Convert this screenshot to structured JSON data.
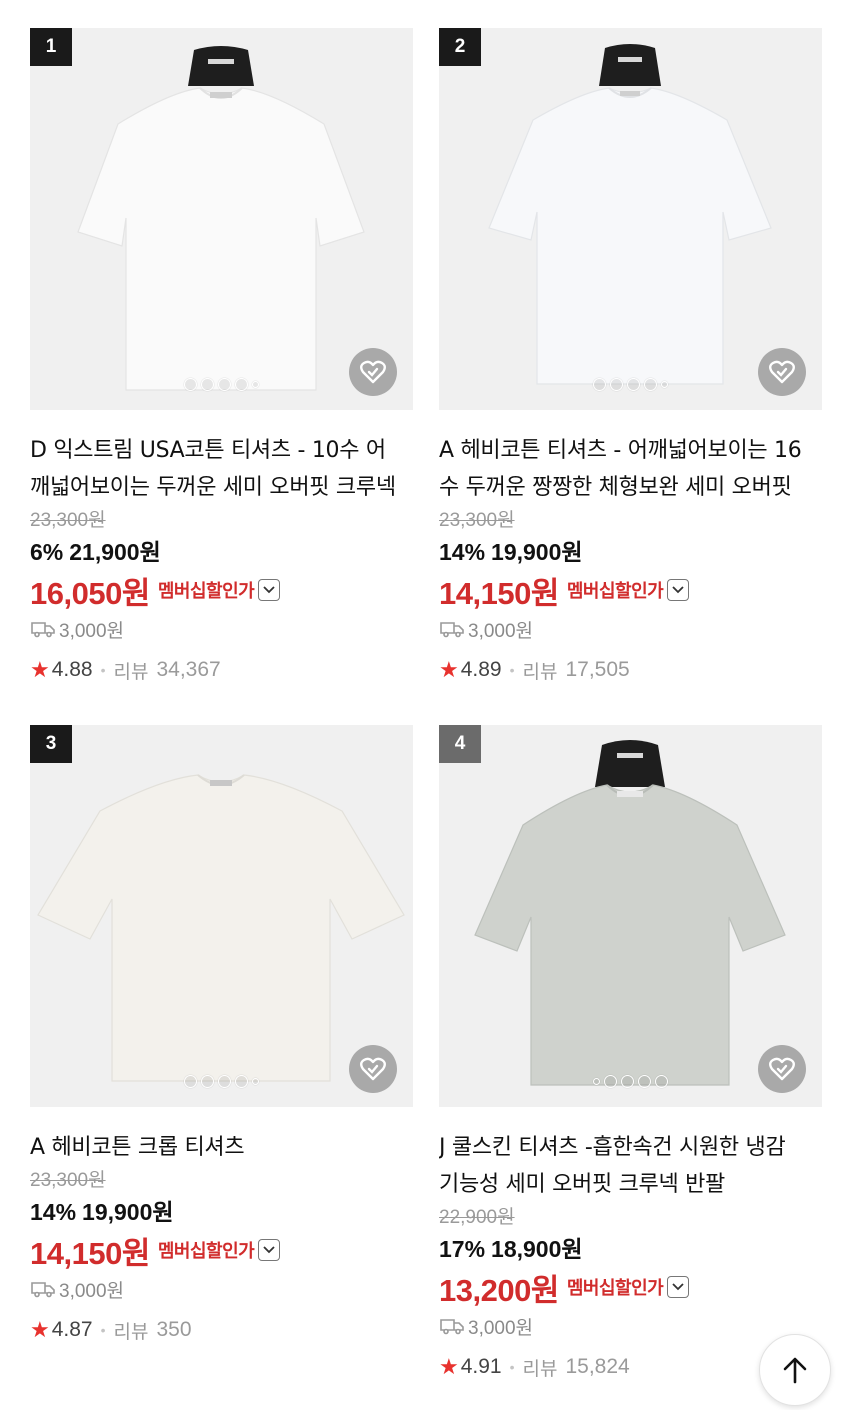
{
  "products": [
    {
      "rank": "1",
      "title": "D 익스트림 USA코튼 티셔츠 - 10수 어깨넓어보이는 두꺼운 세미 오버핏 크루넥",
      "original_price": "23,300원",
      "discount_pct": "6%",
      "sale_price": "21,900원",
      "member_price": "16,050원",
      "member_label": "멤버십할인가",
      "shipping": "3,000원",
      "rating": "4.88",
      "review_label": "리뷰",
      "review_count": "34,367",
      "shirt_color": "#fafafa",
      "hanger": true
    },
    {
      "rank": "2",
      "title": "A 헤비코튼 티셔츠 - 어깨넓어보이는 16수 두꺼운 짱짱한 체형보완 세미 오버핏",
      "original_price": "23,300원",
      "discount_pct": "14%",
      "sale_price": "19,900원",
      "member_price": "14,150원",
      "member_label": "멤버십할인가",
      "shipping": "3,000원",
      "rating": "4.89",
      "review_label": "리뷰",
      "review_count": "17,505",
      "shirt_color": "#f7f8fa",
      "hanger": true
    },
    {
      "rank": "3",
      "title": "A 헤비코튼 크롭 티셔츠",
      "original_price": "23,300원",
      "discount_pct": "14%",
      "sale_price": "19,900원",
      "member_price": "14,150원",
      "member_label": "멤버십할인가",
      "shipping": "3,000원",
      "rating": "4.87",
      "review_label": "리뷰",
      "review_count": "350",
      "shirt_color": "#f3f1ec",
      "hanger": false
    },
    {
      "rank": "4",
      "title": "J 쿨스킨 티셔츠 -흡한속건 시원한 냉감 기능성 세미 오버핏 크루넥 반팔",
      "original_price": "22,900원",
      "discount_pct": "17%",
      "sale_price": "18,900원",
      "member_price": "13,200원",
      "member_label": "멤버십할인가",
      "shipping": "3,000원",
      "rating": "4.91",
      "review_label": "리뷰",
      "review_count": "15,824",
      "shirt_color": "#cfd2cd",
      "hanger": true
    }
  ],
  "colors": {
    "accent_red": "#d12c2c",
    "star": "#e8322e",
    "rank_badge": "#1a1a1a"
  },
  "icons": {
    "like": "heart-check-icon",
    "shipping": "truck-icon",
    "scroll_top": "arrow-up-icon",
    "expand": "chevron-down-icon"
  }
}
